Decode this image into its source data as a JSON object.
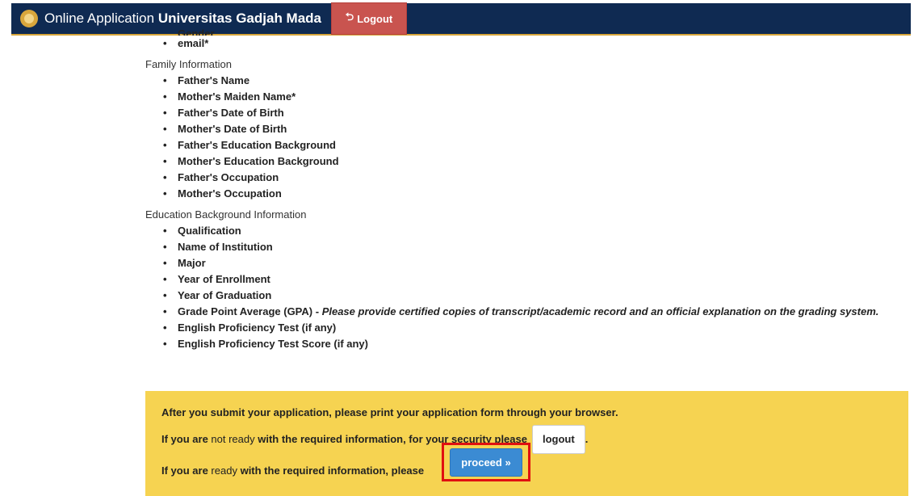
{
  "header": {
    "title_prefix": "Online Application",
    "title_strong": "Universitas Gadjah Mada",
    "logout_label": "Logout",
    "colors": {
      "navbar": "#0f2a52",
      "logout": "#c9544f"
    }
  },
  "personal_items_partial": [
    "Gender",
    "email*"
  ],
  "family": {
    "title": "Family Information",
    "items": [
      "Father's Name",
      "Mother's Maiden Name*",
      "Father's Date of Birth",
      "Mother's Date of Birth",
      "Father's Education Background",
      "Mother's Education Background",
      "Father's Occupation",
      "Mother's Occupation"
    ]
  },
  "education": {
    "title": "Education Background Information",
    "items": [
      "Qualification",
      "Name of Institution",
      "Major",
      "Year of Enrollment",
      "Year of Graduation"
    ],
    "gpa_label": "Grade Point Average (GPA) -",
    "gpa_note": "Please provide certified copies of transcript/academic record and an official explanation on the grading system.",
    "items_after": [
      "English Proficiency Test (if any)",
      "English Proficiency Test Score (if any)"
    ]
  },
  "notice": {
    "line1": "After you submit your application, please print your application form through your browser.",
    "line2_a": "If you are",
    "line2_b": "not ready",
    "line2_c": "with the required information, for your security please",
    "logout_button": "logout",
    "line2_end": ".",
    "line3_a": "If you are",
    "line3_b": "ready",
    "line3_c": "with the required information, please",
    "proceed_button": "proceed »",
    "colors": {
      "background": "#f6d351",
      "proceed": "#3b8bd3",
      "highlight": "#e01010"
    }
  }
}
